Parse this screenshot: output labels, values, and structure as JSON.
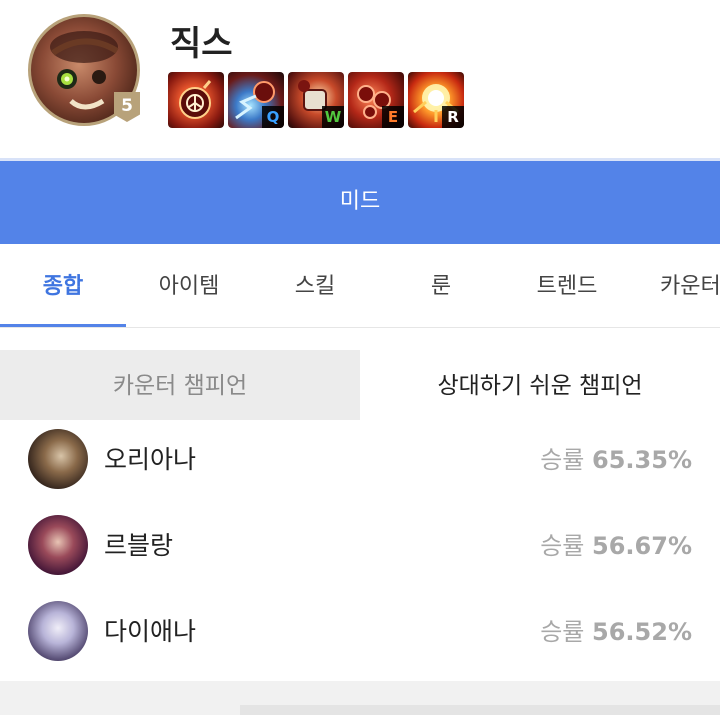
{
  "champion": {
    "name": "직스",
    "level": "5",
    "skills": [
      {
        "key": "",
        "icon": "passive-bomb-icon"
      },
      {
        "key": "Q",
        "icon": "bouncing-bomb-icon"
      },
      {
        "key": "W",
        "icon": "satchel-charge-icon"
      },
      {
        "key": "E",
        "icon": "hexplosive-minefield-icon"
      },
      {
        "key": "R",
        "icon": "mega-inferno-bomb-icon"
      }
    ]
  },
  "role": "미드",
  "tabs": [
    "종합",
    "아이템",
    "스킬",
    "룬",
    "트렌드",
    "카운터"
  ],
  "active_tab": "종합",
  "sub_tabs": {
    "counter": "카운터 챔피언",
    "easy": "상대하기 쉬운 챔피언"
  },
  "matchups": [
    {
      "name": "오리아나",
      "rate_label": "승률",
      "rate": "65.35%"
    },
    {
      "name": "르블랑",
      "rate_label": "승률",
      "rate": "56.67%"
    },
    {
      "name": "다이애나",
      "rate_label": "승률",
      "rate": "56.52%"
    }
  ],
  "colors": {
    "accent": "#5383e8",
    "active_tab_text": "#3f75e0",
    "q_key": "#39a0ff",
    "w_key": "#52c840",
    "e_key": "#ff7a2a"
  }
}
